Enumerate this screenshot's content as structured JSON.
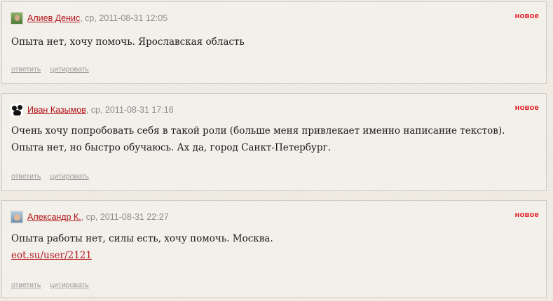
{
  "new_label": "новое",
  "reply_label": "ответить",
  "quote_label": "цитировать",
  "comments": [
    {
      "author": "Алиев Денис",
      "meta": ", ср, 2011-08-31 12:05",
      "text": "Опыта нет, хочу помочь. Ярославская область",
      "link": ""
    },
    {
      "author": "Иван Казымов",
      "meta": ", ср, 2011-08-31 17:16",
      "text": "Очень хочу попробовать себя в такой роли (больше меня привлекает именно написание текстов). Опыта нет, но быстро обучаюсь. Ах да, город Санкт-Петербург.",
      "link": ""
    },
    {
      "author": "Александр К.",
      "meta": ", ср, 2011-08-31 22:27",
      "text": "Опыта работы нет, силы есть, хочу помочь. Москва.",
      "link": "eot.su/user/2121"
    }
  ],
  "colors": {
    "author_link": "#b3151b",
    "new_badge": "#e0111a",
    "muted": "#8c8c8c"
  }
}
